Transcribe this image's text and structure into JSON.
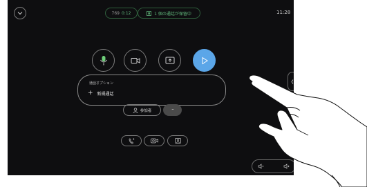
{
  "status": {
    "participant_code": "769",
    "call_duration": "0:12",
    "hold_text": "1 個の通話が保留中",
    "clock": "11:28"
  },
  "options_panel": {
    "title": "通話オプション",
    "new_call_label": "新規通話",
    "new_call_glyph": "+"
  },
  "participants_label": "参加者",
  "more_glyph": "···",
  "icons": {
    "menu": "chevron-down-icon",
    "mic": "microphone-icon",
    "camera": "camera-icon",
    "share": "share-screen-icon",
    "send": "send-icon",
    "participants": "person-icon",
    "transfer": "transfer-call-icon",
    "video_switch": "video-switch-icon",
    "self_view": "self-view-icon",
    "vol_down": "volume-down-icon",
    "vol_up": "volume-up-icon",
    "side_panel": "chevron-left-icon"
  },
  "colors": {
    "background": "#0e0e10",
    "green_accent": "#5fb57a",
    "blue_button": "#5ba6e8",
    "mic_green": "#6fcf7a"
  }
}
